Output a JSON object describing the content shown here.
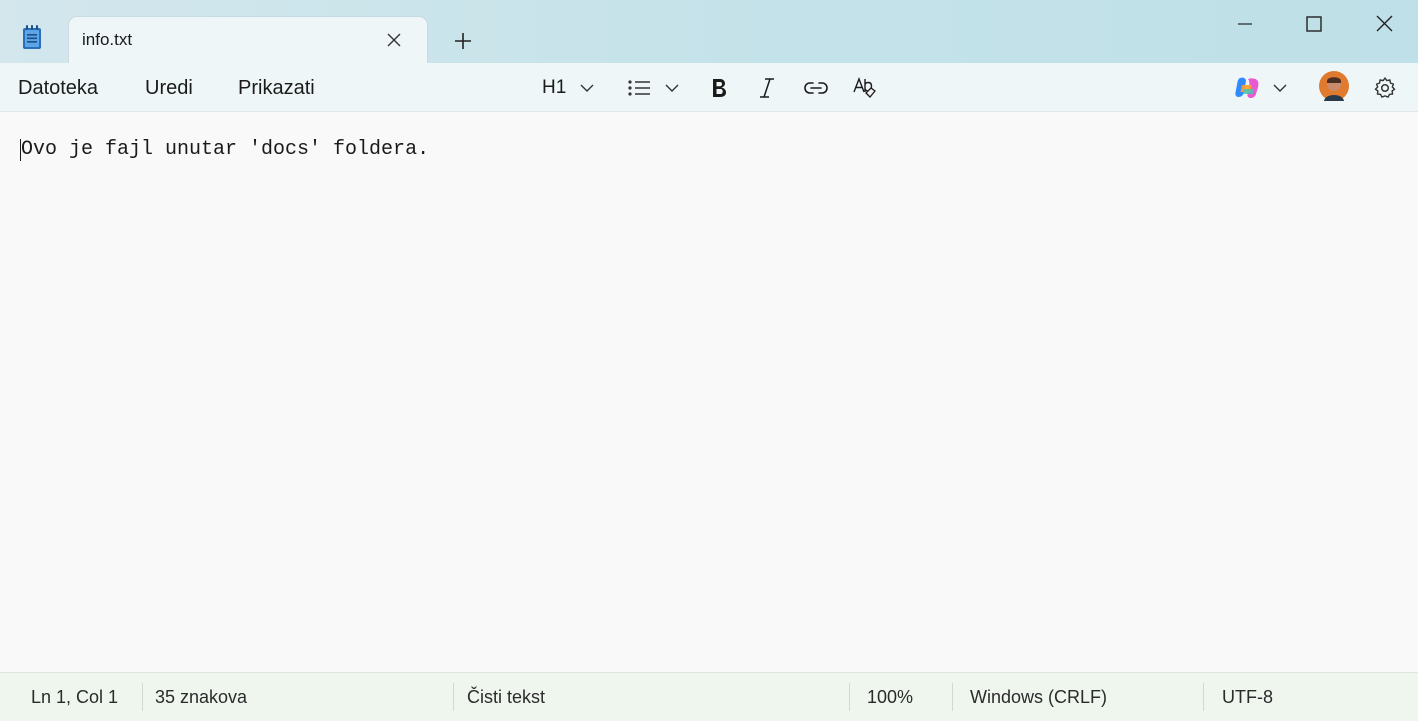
{
  "window": {
    "tab_title": "info.txt",
    "icons": {
      "app": "notepad-icon",
      "tab_close": "close-icon",
      "new_tab": "plus-icon",
      "minimize": "minimize-icon",
      "maximize": "maximize-icon",
      "close": "close-icon"
    }
  },
  "menu": {
    "items": [
      "Datoteka",
      "Uredi",
      "Prikazati"
    ]
  },
  "toolbar": {
    "heading_label": "H1",
    "icons": [
      "chevron-down-icon",
      "list-icon",
      "bold-icon",
      "italic-icon",
      "link-icon",
      "clear-formatting-icon",
      "copilot-icon",
      "avatar",
      "gear-icon"
    ]
  },
  "editor": {
    "content": "Ovo je fajl unutar 'docs' foldera."
  },
  "status": {
    "position": "Ln 1, Col 1",
    "chars": "35 znakova",
    "format": "Čisti tekst",
    "zoom": "100%",
    "line_ending": "Windows (CRLF)",
    "encoding": "UTF-8"
  },
  "colors": {
    "titlebar": "#c4e2e9",
    "tab": "#eef6f7",
    "editor_bg": "#f9f9f9",
    "statusbar": "#eef6ee"
  }
}
